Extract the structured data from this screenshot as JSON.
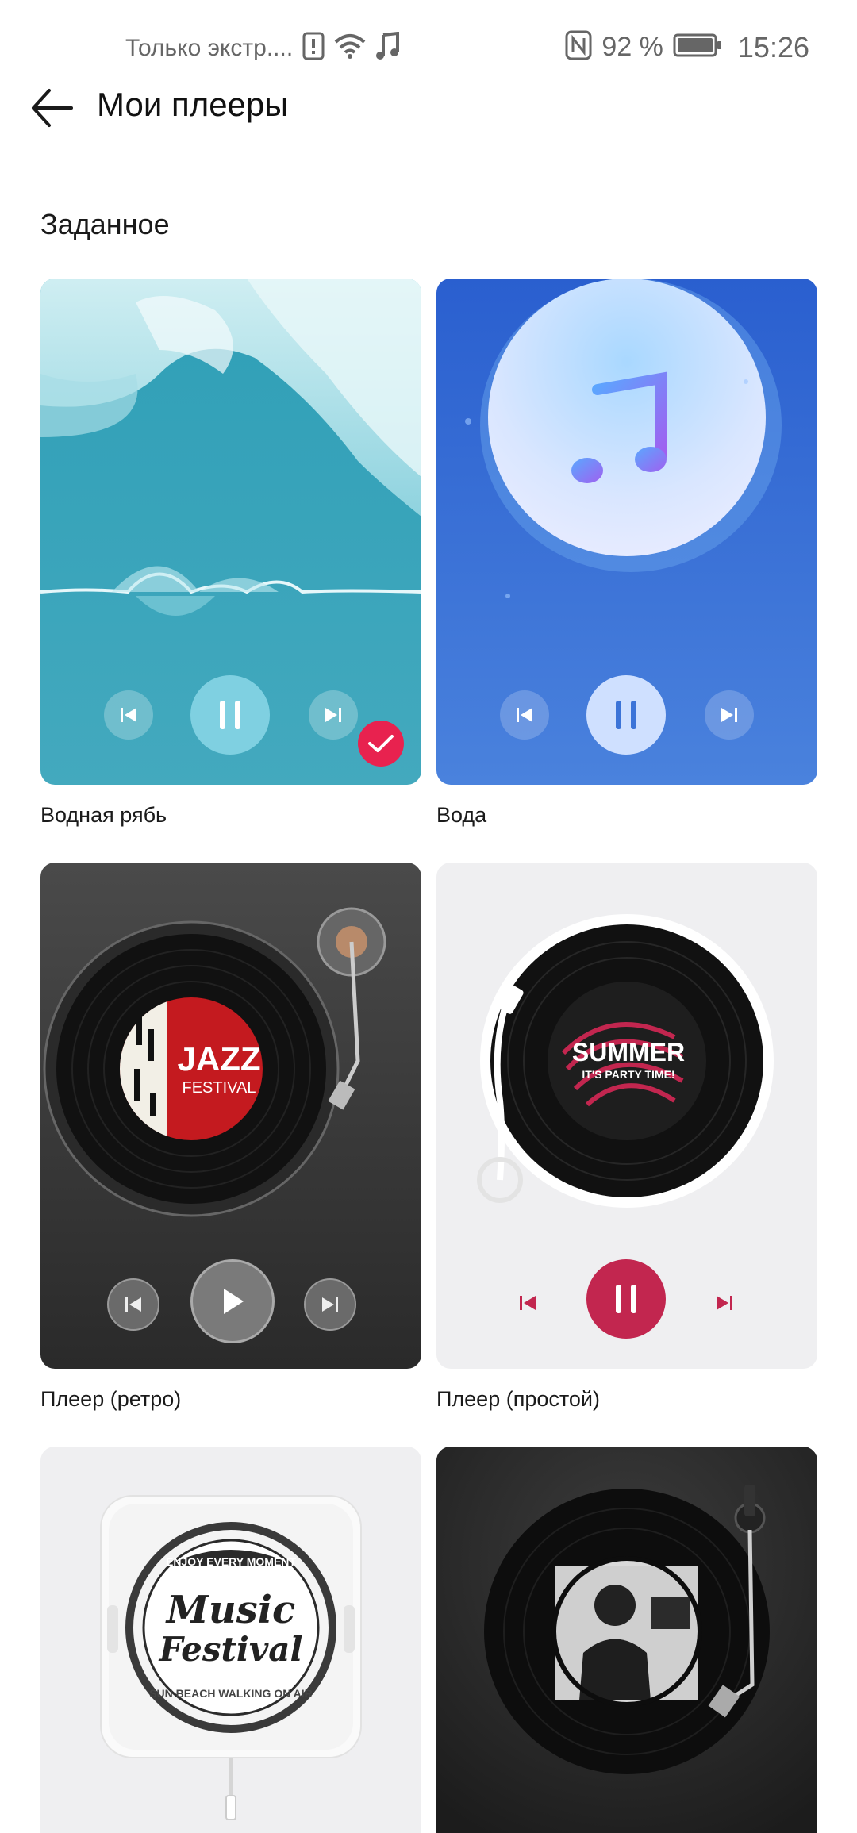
{
  "status_bar": {
    "carrier_text": "Только экстр....",
    "battery_percent": "92 %",
    "time": "15:26",
    "icons": [
      "alert-icon",
      "wifi-icon",
      "music-note-icon",
      "nfc-icon",
      "battery-icon"
    ]
  },
  "header": {
    "title": "Мои плееры",
    "back_icon": "arrow-left-icon"
  },
  "section": {
    "title": "Заданное"
  },
  "players": [
    {
      "name": "Водная рябь",
      "selected": true,
      "state": "pause"
    },
    {
      "name": "Вода",
      "selected": false,
      "state": "pause"
    },
    {
      "name": "Плеер (ретро)",
      "selected": false,
      "state": "play"
    },
    {
      "name": "Плеер (простой)",
      "selected": false,
      "state": "pause"
    },
    {
      "name": "",
      "selected": false
    },
    {
      "name": "",
      "selected": false
    }
  ],
  "artwork": {
    "jazz_word": "JAZZ",
    "jazz_sub": "FESTIVAL",
    "summer_word": "SUMMER",
    "summer_sub": "IT'S PARTY TIME!",
    "music_word": "Music",
    "festival_word": "Festival",
    "ring_top": "ENJOY EVERY MOMENT",
    "ring_bottom": "SUN BEACH WALKING ON AIR"
  },
  "colors": {
    "accent_pink": "#e8224f",
    "water_teal": "#3aa5bd",
    "water_blue": "#3c74d8",
    "retro_dark": "#3a3a3a",
    "simple_red": "#c2264f"
  }
}
